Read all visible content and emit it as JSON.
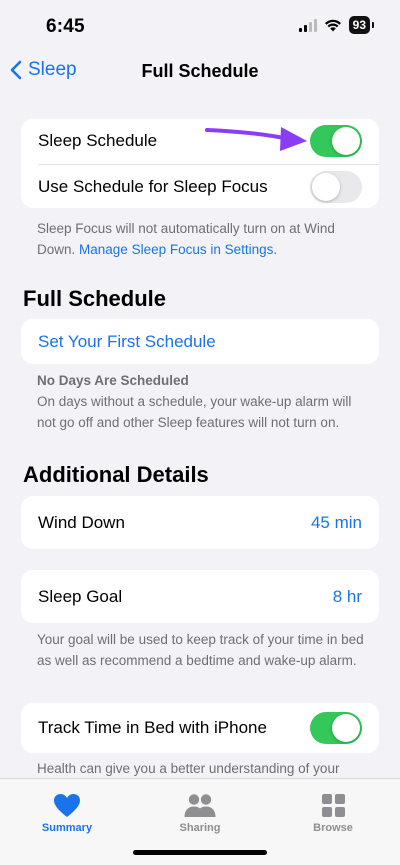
{
  "status_bar": {
    "time": "6:45",
    "battery": "93"
  },
  "nav": {
    "back_label": "Sleep",
    "title": "Full Schedule"
  },
  "sleep_card": {
    "sleep_schedule_label": "Sleep Schedule",
    "sleep_schedule_on": true,
    "focus_label": "Use Schedule for Sleep Focus",
    "focus_on": false
  },
  "focus_note": {
    "text": "Sleep Focus will not automatically turn on at Wind Down.",
    "link": "Manage Sleep Focus in Settings."
  },
  "full_schedule": {
    "heading": "Full Schedule",
    "set_first_schedule": "Set Your First Schedule",
    "note_title": "No Days Are Scheduled",
    "note_text": "On days without a schedule, your wake-up alarm will not go off and other Sleep features will not turn on."
  },
  "additional_details": {
    "heading": "Additional Details",
    "wind_down_label": "Wind Down",
    "wind_down_value": "45 min",
    "sleep_goal_label": "Sleep Goal",
    "sleep_goal_value": "8 hr",
    "sleep_goal_note": "Your goal will be used to keep track of your time in bed as well as recommend a bedtime and wake-up alarm.",
    "track_label": "Track Time in Bed with iPhone",
    "track_on": true,
    "track_note": "Health can give you a better understanding of your"
  },
  "annotation": {
    "arrow_color": "#8b3cf7"
  },
  "tabs": [
    {
      "label": "Summary",
      "icon": "heart-icon",
      "active": true
    },
    {
      "label": "Sharing",
      "icon": "people-icon",
      "active": false
    },
    {
      "label": "Browse",
      "icon": "grid-icon",
      "active": false
    }
  ],
  "colors": {
    "accent": "#1a73e8",
    "toggle_on": "#34c759",
    "tab_inactive": "#8e8e93"
  }
}
